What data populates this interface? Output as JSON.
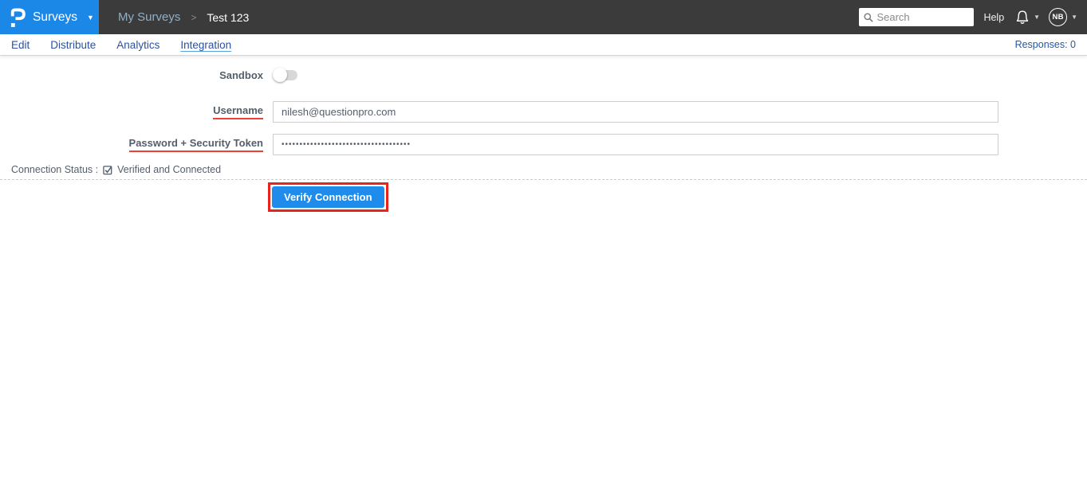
{
  "topbar": {
    "product": "Surveys",
    "breadcrumb_parent": "My Surveys",
    "breadcrumb_separator": ">",
    "breadcrumb_current": "Test 123",
    "search_placeholder": "Search",
    "help": "Help",
    "avatar_initials": "NB"
  },
  "tabbar": {
    "tabs": [
      {
        "label": "Edit"
      },
      {
        "label": "Distribute"
      },
      {
        "label": "Analytics"
      },
      {
        "label": "Integration"
      }
    ],
    "active_tab": "Integration",
    "responses": "Responses: 0"
  },
  "form": {
    "sandbox_label": "Sandbox",
    "sandbox_state": "off",
    "username_label": "Username",
    "username_value": "nilesh@questionpro.com",
    "password_label": "Password + Security Token",
    "password_masked_value": "••••••••••••••••••••••••••••••••••••",
    "connection_status_label": "Connection Status :",
    "connection_status_value": "Verified and Connected",
    "verify_button": "Verify Connection"
  },
  "colors": {
    "brand_blue": "#1b87e6",
    "topbar_dark": "#3b3b3b",
    "tab_link_blue": "#2b52a0",
    "label_gray": "#545e6b",
    "underline_red": "#ef4036",
    "annotation_red": "#e8251c",
    "button_blue": "#1f8ceb"
  }
}
